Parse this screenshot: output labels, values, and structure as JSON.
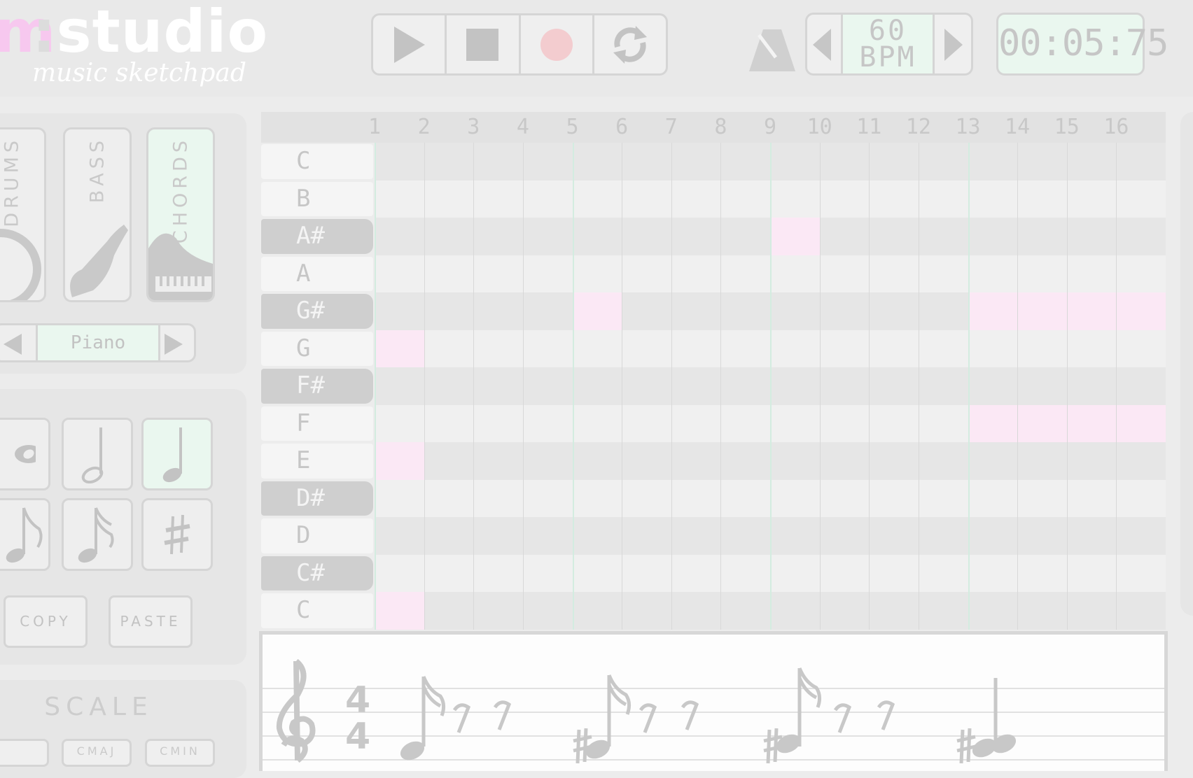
{
  "app": {
    "logo_m": "m",
    "logo_colon": ":",
    "logo_word": "studio",
    "subtitle": "music sketchpad"
  },
  "transport": {
    "buttons": [
      "play",
      "stop",
      "record",
      "loop"
    ]
  },
  "tempo": {
    "value": "60",
    "unit": "BPM"
  },
  "timer": {
    "display": "00:05:75"
  },
  "instruments": [
    {
      "label": "DRUMS",
      "selected": false
    },
    {
      "label": "BASS",
      "selected": false
    },
    {
      "label": "CHORDS",
      "selected": true
    }
  ],
  "voice": {
    "name": "Piano"
  },
  "note_tools": [
    {
      "icon": "whole-note-icon",
      "selected": false
    },
    {
      "icon": "half-note-icon",
      "selected": false
    },
    {
      "icon": "quarter-note-icon",
      "selected": true
    },
    {
      "icon": "eighth-note-icon",
      "selected": false
    },
    {
      "icon": "sixteenth-note-icon",
      "selected": false
    },
    {
      "icon": "sharp-icon",
      "selected": false
    }
  ],
  "edit": {
    "copy_label": "COPY",
    "paste_label": "PASTE"
  },
  "scale": {
    "label": "SCALE",
    "options": [
      "CMAJ",
      "CMIN"
    ]
  },
  "grid": {
    "columns": [
      "1",
      "2",
      "3",
      "4",
      "5",
      "6",
      "7",
      "8",
      "9",
      "10",
      "11",
      "12",
      "13",
      "14",
      "15",
      "16"
    ],
    "rows": [
      {
        "label": "C",
        "sharp": false
      },
      {
        "label": "B",
        "sharp": false
      },
      {
        "label": "A#",
        "sharp": true
      },
      {
        "label": "A",
        "sharp": false
      },
      {
        "label": "G#",
        "sharp": true
      },
      {
        "label": "G",
        "sharp": false
      },
      {
        "label": "F#",
        "sharp": true
      },
      {
        "label": "F",
        "sharp": false
      },
      {
        "label": "E",
        "sharp": false
      },
      {
        "label": "D#",
        "sharp": true
      },
      {
        "label": "D",
        "sharp": false
      },
      {
        "label": "C#",
        "sharp": true
      },
      {
        "label": "C",
        "sharp": false
      }
    ],
    "notes": [
      {
        "row": 5,
        "step": 1,
        "length": 1
      },
      {
        "row": 8,
        "step": 1,
        "length": 1
      },
      {
        "row": 12,
        "step": 1,
        "length": 1
      },
      {
        "row": 4,
        "step": 5,
        "length": 1
      },
      {
        "row": 2,
        "step": 9,
        "length": 1
      },
      {
        "row": 4,
        "step": 13,
        "length": 4
      },
      {
        "row": 7,
        "step": 13,
        "length": 4
      }
    ]
  },
  "score": {
    "time_signature_top": "4",
    "time_signature_bottom": "4"
  },
  "colors": {
    "accent_green": "#eaf7ef",
    "note_pink": "#fbe8f5",
    "logo_pink": "#f7c8ef",
    "record_red": "#f3cccf"
  }
}
